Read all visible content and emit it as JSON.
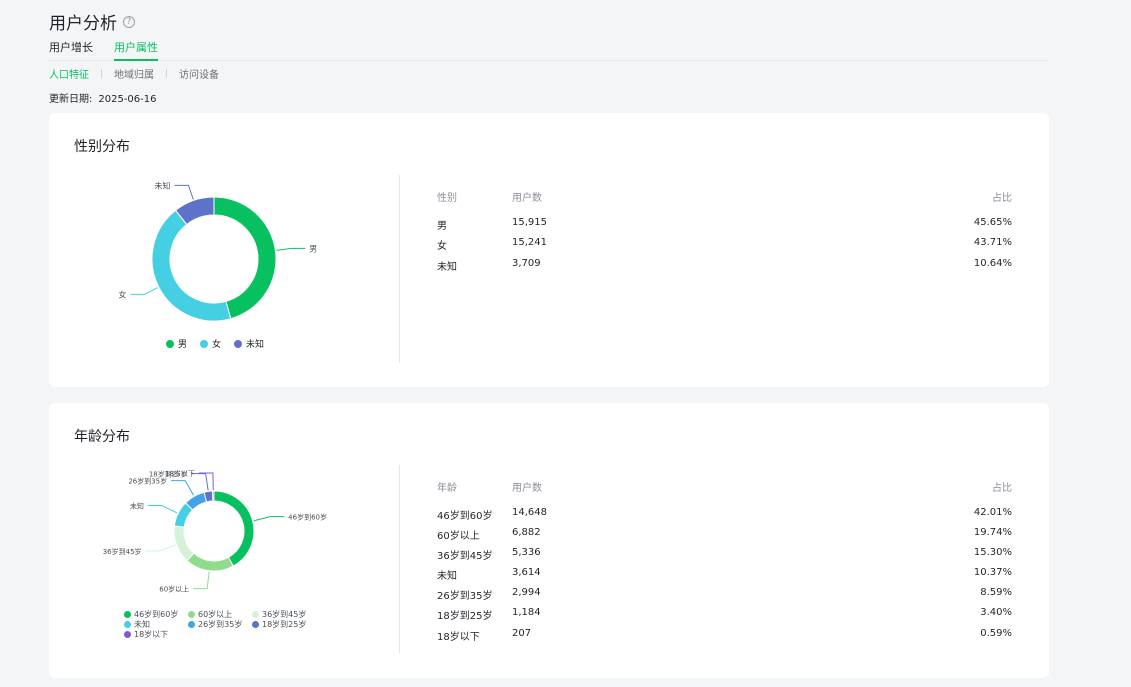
{
  "header": {
    "title": "用户分析",
    "help_icon": "question-circle-icon",
    "tabs": [
      {
        "label": "用户增长"
      },
      {
        "label": "用户属性"
      }
    ],
    "active_tab": "用户属性",
    "subtabs": [
      {
        "label": "人口特征"
      },
      {
        "label": "地域归属"
      },
      {
        "label": "访问设备"
      }
    ],
    "active_subtab": "人口特征",
    "update_label": "更新日期:",
    "update_date": "2025-06-16"
  },
  "gender": {
    "title": "性别分布",
    "headers": {
      "col1": "性别",
      "col2": "用户数",
      "col3": "占比"
    },
    "rows": [
      {
        "name": "男",
        "users": "15,915",
        "pct": "45.65%"
      },
      {
        "name": "女",
        "users": "15,241",
        "pct": "43.71%"
      },
      {
        "name": "未知",
        "users": "3,709",
        "pct": "10.64%"
      }
    ],
    "legend": [
      "男",
      "女",
      "未知"
    ]
  },
  "age": {
    "title": "年龄分布",
    "headers": {
      "col1": "年龄",
      "col2": "用户数",
      "col3": "占比"
    },
    "rows": [
      {
        "name": "46岁到60岁",
        "users": "14,648",
        "pct": "42.01%"
      },
      {
        "name": "60岁以上",
        "users": "6,882",
        "pct": "19.74%"
      },
      {
        "name": "36岁到45岁",
        "users": "5,336",
        "pct": "15.30%"
      },
      {
        "name": "未知",
        "users": "3,614",
        "pct": "10.37%"
      },
      {
        "name": "26岁到35岁",
        "users": "2,994",
        "pct": "8.59%"
      },
      {
        "name": "18岁到25岁",
        "users": "1,184",
        "pct": "3.40%"
      },
      {
        "name": "18岁以下",
        "users": "207",
        "pct": "0.59%"
      }
    ],
    "legend": [
      "46岁到60岁",
      "60岁以上",
      "36岁到45岁",
      "未知",
      "26岁到35岁",
      "18岁到25岁",
      "18岁以下"
    ]
  },
  "chart_data": [
    {
      "type": "pie",
      "title": "性别分布",
      "categories": [
        "男",
        "女",
        "未知"
      ],
      "values": [
        45.65,
        43.71,
        10.64
      ],
      "colors": [
        "#07c160",
        "#45cfe3",
        "#5e72c9"
      ],
      "legend_position": "bottom"
    },
    {
      "type": "pie",
      "title": "年龄分布",
      "categories": [
        "46岁到60岁",
        "60岁以上",
        "36岁到45岁",
        "未知",
        "26岁到35岁",
        "18岁到25岁",
        "18岁以下"
      ],
      "values": [
        42.01,
        19.74,
        15.3,
        10.37,
        8.59,
        3.4,
        0.59
      ],
      "colors": [
        "#07c160",
        "#8fdc8c",
        "#d4f2d7",
        "#45cfe3",
        "#43a3e8",
        "#5e72c9",
        "#7c5cd6"
      ],
      "legend_position": "bottom"
    }
  ]
}
